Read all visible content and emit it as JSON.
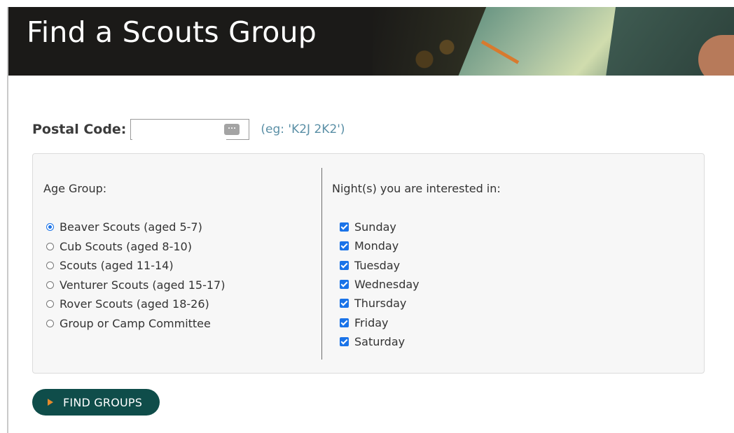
{
  "banner": {
    "title": "Find a Scouts Group"
  },
  "postal": {
    "label": "Postal Code:",
    "value": "",
    "placeholder": "",
    "more_icon": "ellipsis-icon",
    "hint": "(eg: 'K2J 2K2')"
  },
  "age_group": {
    "title": "Age Group:",
    "selected": 0,
    "options": [
      "Beaver Scouts (aged 5-7)",
      "Cub Scouts (aged 8-10)",
      "Scouts (aged 11-14)",
      "Venturer Scouts (aged 15-17)",
      "Rover Scouts (aged 18-26)",
      "Group or Camp Committee"
    ]
  },
  "nights": {
    "title": "Night(s) you are interested in:",
    "options": [
      {
        "label": "Sunday",
        "checked": true
      },
      {
        "label": "Monday",
        "checked": true
      },
      {
        "label": "Tuesday",
        "checked": true
      },
      {
        "label": "Wednesday",
        "checked": true
      },
      {
        "label": "Thursday",
        "checked": true
      },
      {
        "label": "Friday",
        "checked": true
      },
      {
        "label": "Saturday",
        "checked": true
      }
    ]
  },
  "find_button": {
    "label": "FIND GROUPS",
    "icon": "play-arrow-icon"
  },
  "colors": {
    "banner_bg": "#1b1a18",
    "button_bg": "#0f4d4a",
    "button_arrow": "#e58a2c",
    "hint": "#5a8fa6",
    "check_blue": "#1a73e8"
  }
}
